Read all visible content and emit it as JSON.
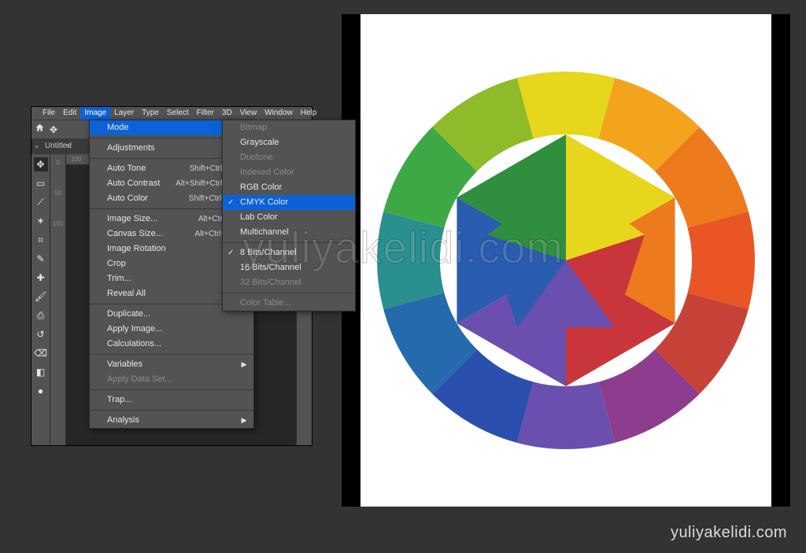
{
  "watermark_center": "yuliyakelidi.com",
  "watermark_corner": "yuliyakelidi.com",
  "menubar": [
    "File",
    "Edit",
    "Image",
    "Layer",
    "Type",
    "Select",
    "Filter",
    "3D",
    "View",
    "Window",
    "Help"
  ],
  "tab": "Untitled",
  "ruler_h": "100",
  "ruler_v": [
    "0",
    "50",
    "100"
  ],
  "image_menu": {
    "mode": "Mode",
    "adjustments": "Adjustments",
    "auto_tone": "Auto Tone",
    "auto_tone_sc": "Shift+Ctrl+L",
    "auto_contrast": "Auto Contrast",
    "auto_contrast_sc": "Alt+Shift+Ctrl+L",
    "auto_color": "Auto Color",
    "auto_color_sc": "Shift+Ctrl+B",
    "image_size": "Image Size...",
    "image_size_sc": "Alt+Ctrl+I",
    "canvas_size": "Canvas Size...",
    "canvas_size_sc": "Alt+Ctrl+C",
    "image_rotation": "Image Rotation",
    "crop": "Crop",
    "trim": "Trim...",
    "reveal_all": "Reveal All",
    "duplicate": "Duplicate...",
    "apply_image": "Apply Image...",
    "calculations": "Calculations...",
    "variables": "Variables",
    "apply_data": "Apply Data Set...",
    "trap": "Trap...",
    "analysis": "Analysis"
  },
  "mode_menu": {
    "bitmap": "Bitmap",
    "grayscale": "Grayscale",
    "duotone": "Duotone",
    "indexed": "Indexed Color",
    "rgb": "RGB Color",
    "cmyk": "CMYK Color",
    "lab": "Lab Color",
    "multichannel": "Multichannel",
    "bits8": "8 Bits/Channel",
    "bits16": "16 Bits/Channel",
    "bits32": "32 Bits/Channel",
    "color_table": "Color Table..."
  },
  "color_wheel": {
    "ring": [
      "#e6d71c",
      "#f3a31c",
      "#ed7a1d",
      "#e95525",
      "#c74339",
      "#8e3d8e",
      "#6a4fae",
      "#2a4fae",
      "#256aac",
      "#2a8f8f",
      "#3ea845",
      "#8fba2a"
    ],
    "hexagon": [
      "#e6d71c",
      "#ed7a1d",
      "#c8363b",
      "#6a4fae",
      "#2a5cb0",
      "#2f8f3f"
    ],
    "inner_penta": [
      "#e6d71c",
      "#c8363b",
      "#6a4fae",
      "#2a5cb0",
      "#2f8f3f"
    ]
  }
}
